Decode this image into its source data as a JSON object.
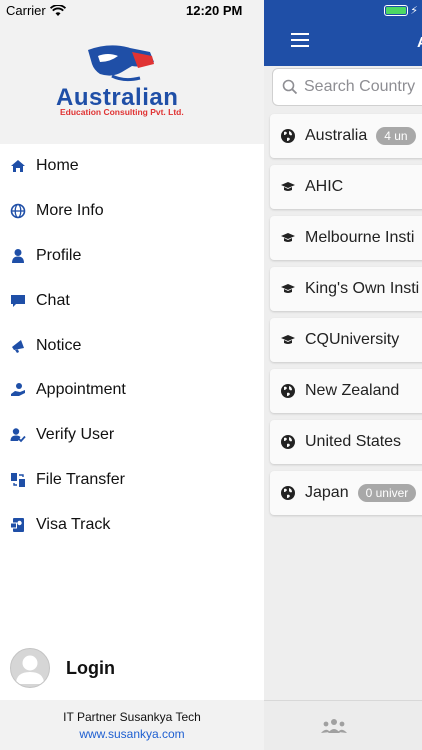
{
  "status_bar": {
    "carrier": "Carrier",
    "time": "12:20 PM"
  },
  "drawer": {
    "logo": {
      "name": "Australian",
      "subtitle": "Education Consulting Pvt. Ltd."
    },
    "nav_items": [
      {
        "label": "Home",
        "icon": "home-icon"
      },
      {
        "label": "More Info",
        "icon": "globe-icon"
      },
      {
        "label": "Profile",
        "icon": "user-icon"
      },
      {
        "label": "Chat",
        "icon": "chat-icon"
      },
      {
        "label": "Notice",
        "icon": "megaphone-icon"
      },
      {
        "label": "Appointment",
        "icon": "appointment-icon"
      },
      {
        "label": "Verify User",
        "icon": "verify-user-icon"
      },
      {
        "label": "File Transfer",
        "icon": "file-transfer-icon"
      },
      {
        "label": "Visa Track",
        "icon": "visa-icon"
      }
    ],
    "login_label": "Login",
    "footer": {
      "partner_text": "IT Partner  Susankya Tech",
      "website": "www.susankya.com"
    }
  },
  "main": {
    "header_title": "A",
    "search": {
      "placeholder": "Search Country"
    },
    "items": [
      {
        "label": "Australia",
        "type": "country",
        "badge": "4 un"
      },
      {
        "label": "AHIC",
        "type": "institution",
        "badge": ""
      },
      {
        "label": "Melbourne Insti",
        "type": "institution",
        "badge": ""
      },
      {
        "label": "King's Own Insti",
        "type": "institution",
        "badge": ""
      },
      {
        "label": "CQUniversity",
        "type": "institution",
        "badge": ""
      },
      {
        "label": "New Zealand",
        "type": "country",
        "badge": ""
      },
      {
        "label": "United States",
        "type": "country",
        "badge": ""
      },
      {
        "label": "Japan",
        "type": "country",
        "badge": "0 univer"
      }
    ]
  },
  "colors": {
    "brand_blue": "#1f4fa7",
    "brand_red": "#e03333",
    "link_blue": "#1e5fd1",
    "badge_gray": "#a8a8a8"
  }
}
